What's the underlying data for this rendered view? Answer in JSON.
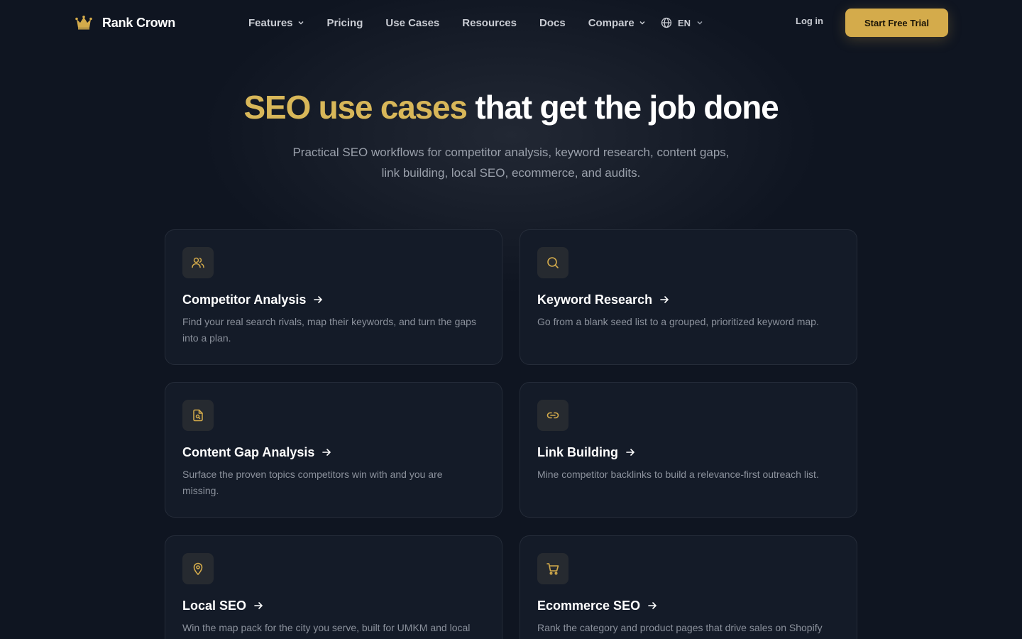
{
  "brand": {
    "name": "Rank Crown",
    "icon": "crown-icon",
    "accent": "#d4ab4b"
  },
  "nav": {
    "items": [
      {
        "label": "Features",
        "dropdown": true
      },
      {
        "label": "Pricing",
        "dropdown": false
      },
      {
        "label": "Use Cases",
        "dropdown": false
      },
      {
        "label": "Resources",
        "dropdown": false
      },
      {
        "label": "Docs",
        "dropdown": false
      },
      {
        "label": "Compare",
        "dropdown": true
      }
    ],
    "language": "EN",
    "login": "Log in",
    "cta": "Start Free Trial"
  },
  "hero": {
    "title_highlight": "SEO use cases",
    "title_rest": "that get the job done",
    "subtitle": "Practical SEO workflows for competitor analysis, keyword research, content gaps, link building, local SEO, ecommerce, and audits."
  },
  "cards": [
    {
      "icon": "users-icon",
      "title": "Competitor Analysis",
      "description": "Find your real search rivals, map their keywords, and turn the gaps into a plan."
    },
    {
      "icon": "search-icon",
      "title": "Keyword Research",
      "description": "Go from a blank seed list to a grouped, prioritized keyword map."
    },
    {
      "icon": "file-search-icon",
      "title": "Content Gap Analysis",
      "description": "Surface the proven topics competitors win with and you are missing."
    },
    {
      "icon": "link-icon",
      "title": "Link Building",
      "description": "Mine competitor backlinks to build a relevance-first outreach list."
    },
    {
      "icon": "map-pin-icon",
      "title": "Local SEO",
      "description": "Win the map pack for the city you serve, built for UMKM and local"
    },
    {
      "icon": "cart-icon",
      "title": "Ecommerce SEO",
      "description": "Rank the category and product pages that drive sales on Shopify"
    }
  ]
}
